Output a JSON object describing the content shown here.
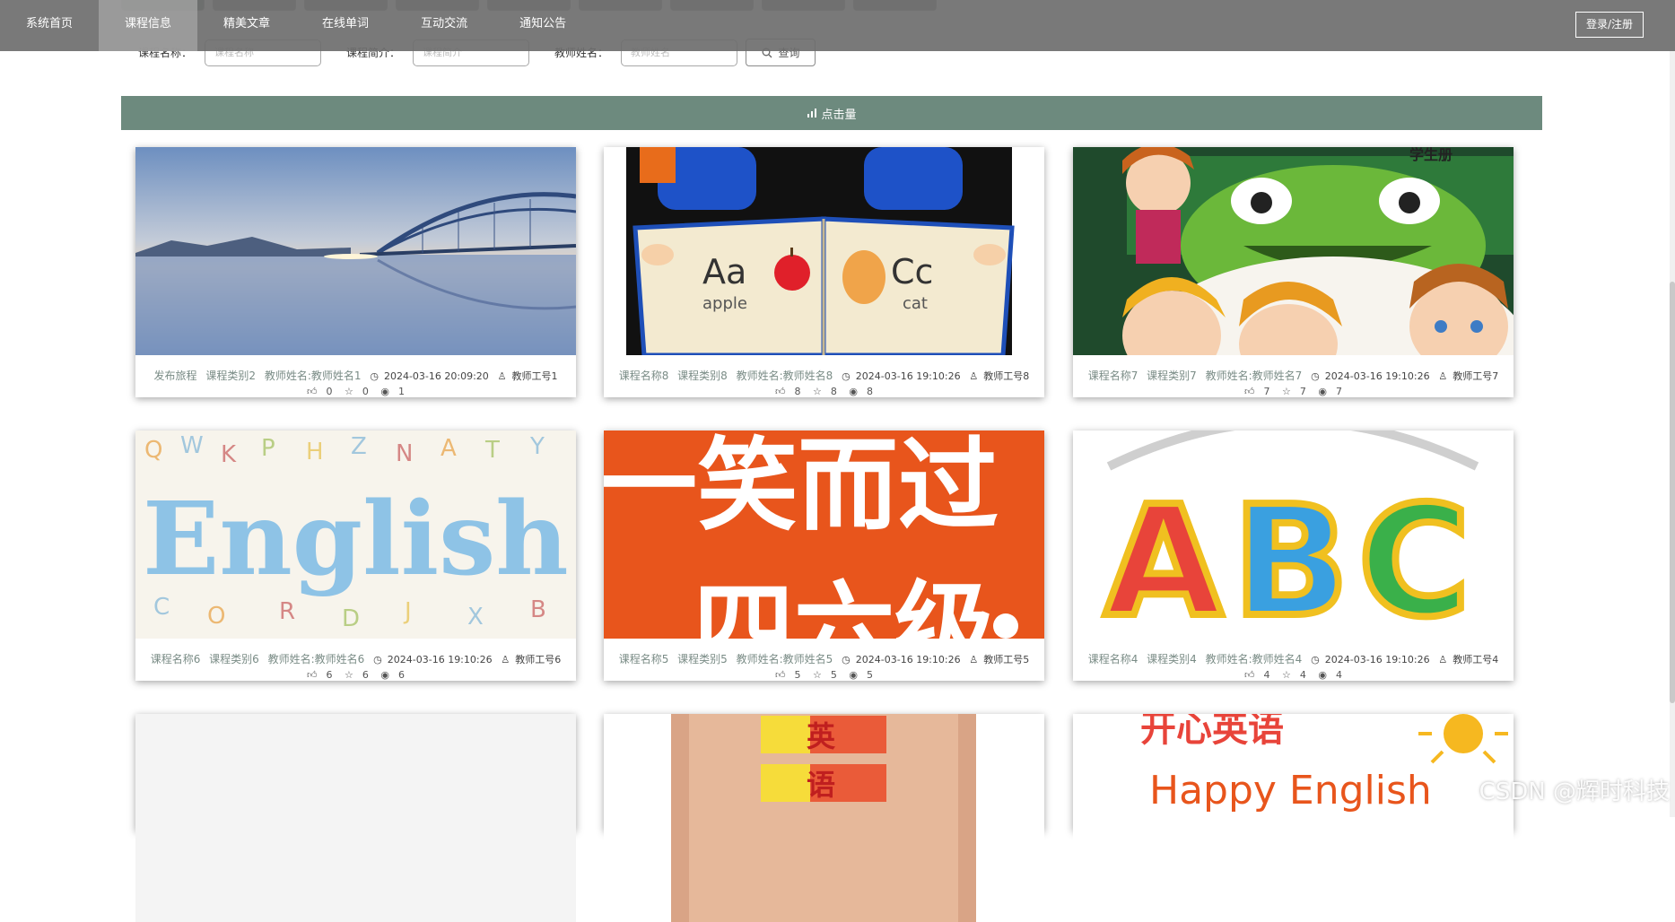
{
  "nav": {
    "items": [
      "系统首页",
      "课程信息",
      "精美文章",
      "在线单词",
      "互动交流",
      "通知公告"
    ],
    "active_index": 1,
    "login": "登录/注册"
  },
  "search": {
    "course_name_label": "课程名称：",
    "course_name_placeholder": "课程名称",
    "course_intro_label": "课程简介：",
    "course_intro_placeholder": "课程简介",
    "teacher_name_label": "教师姓名：",
    "teacher_name_placeholder": "教师姓名",
    "button": "查询"
  },
  "sort_bar": {
    "label": "点击量"
  },
  "cards": [
    {
      "name": "发布旅程",
      "category": "课程类别2",
      "teacher": "教师姓名:教师姓名1",
      "time": "2024-03-16 20:09:20",
      "teacher_id": "教师工号1",
      "likes": "0",
      "favs": "0",
      "views": "1"
    },
    {
      "name": "课程名称8",
      "category": "课程类别8",
      "teacher": "教师姓名:教师姓名8",
      "time": "2024-03-16 19:10:26",
      "teacher_id": "教师工号8",
      "likes": "8",
      "favs": "8",
      "views": "8"
    },
    {
      "name": "课程名称7",
      "category": "课程类别7",
      "teacher": "教师姓名:教师姓名7",
      "time": "2024-03-16 19:10:26",
      "teacher_id": "教师工号7",
      "likes": "7",
      "favs": "7",
      "views": "7"
    },
    {
      "name": "课程名称6",
      "category": "课程类别6",
      "teacher": "教师姓名:教师姓名6",
      "time": "2024-03-16 19:10:26",
      "teacher_id": "教师工号6",
      "likes": "6",
      "favs": "6",
      "views": "6"
    },
    {
      "name": "课程名称5",
      "category": "课程类别5",
      "teacher": "教师姓名:教师姓名5",
      "time": "2024-03-16 19:10:26",
      "teacher_id": "教师工号5",
      "likes": "5",
      "favs": "5",
      "views": "5"
    },
    {
      "name": "课程名称4",
      "category": "课程类别4",
      "teacher": "教师姓名:教师姓名4",
      "time": "2024-03-16 19:10:26",
      "teacher_id": "教师工号4",
      "likes": "4",
      "favs": "4",
      "views": "4"
    }
  ],
  "card_images": {
    "c2": {
      "left_big": "Aa",
      "left_small": "apple",
      "right_big": "Cc",
      "right_small": "cat"
    },
    "c3": {
      "top_text": "学生册"
    },
    "c4": {
      "word": "English"
    },
    "c5": {
      "line1": "一笑而过",
      "line2": "四六级"
    },
    "c6": {
      "word": "ABC"
    },
    "c8": {
      "l1": "英",
      "l2": "语"
    },
    "c9": {
      "top": "开心英语",
      "bottom": "Happy English"
    }
  },
  "watermark": "CSDN @辉时科技",
  "colors": {
    "accent": "#6d8a7e",
    "nav_bg": "#6e6e6e"
  }
}
